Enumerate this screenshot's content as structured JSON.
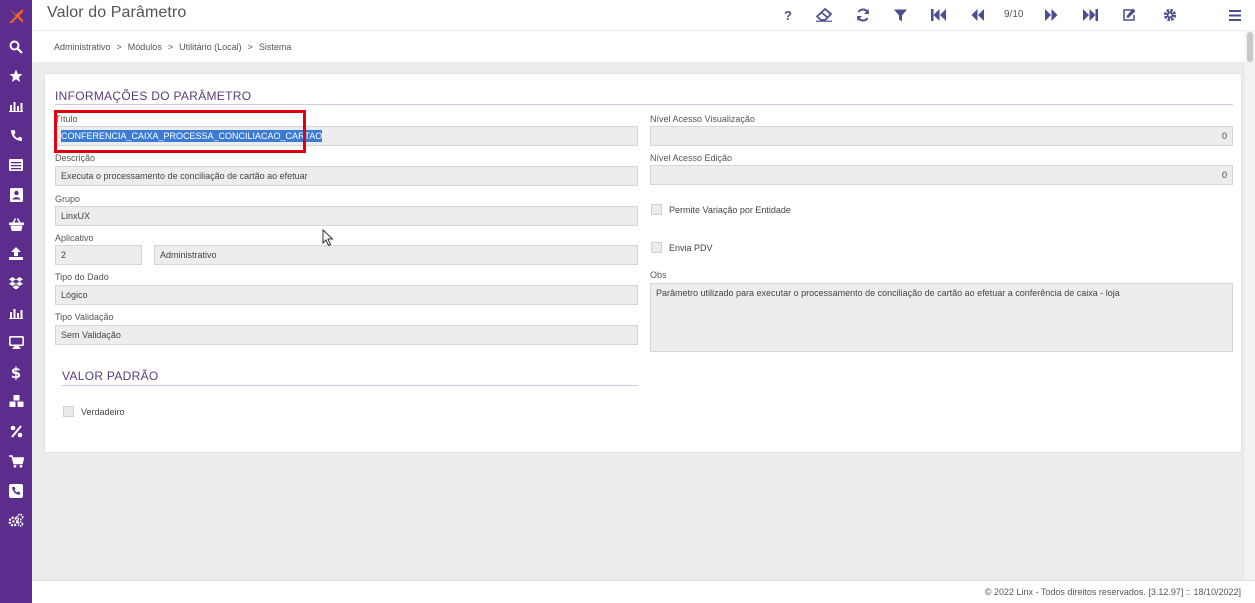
{
  "app": {
    "page_title": "Valor do Parâmetro"
  },
  "colors": {
    "sidebar": "#5c2d8c",
    "accent": "#5a3c7e",
    "selection": "#3a7bd5",
    "highlight_box": "#e0000f"
  },
  "sidebar": {
    "icons": [
      "search-icon",
      "star-icon",
      "bar-chart-icon",
      "phone-icon",
      "list-icon",
      "contact-card-icon",
      "basket-icon",
      "upload-icon",
      "dropbox-icon",
      "bar-chart-icon",
      "monitor-icon",
      "dollar-icon",
      "cubes-icon",
      "percent-icon",
      "cart-icon",
      "phone-square-icon",
      "gears-icon"
    ]
  },
  "toolbar": {
    "help": "?",
    "pager": "9/10",
    "icons": [
      "help-icon",
      "eraser-icon",
      "refresh-icon",
      "filter-icon",
      "first-record-icon",
      "previous-record-icon",
      "next-record-icon",
      "last-record-icon",
      "edit-icon",
      "settings-icon",
      "menu-icon"
    ]
  },
  "breadcrumb": [
    "Administrativo",
    "Módulos",
    "Utilitário (Local)",
    "Sistema"
  ],
  "breadcrumb_separator": ">",
  "info_section": {
    "title": "INFORMAÇÕES DO PARÂMETRO",
    "titulo": {
      "label": "Título",
      "value": "CONFERENCIA_CAIXA_PROCESSA_CONCILIACAO_CARTAO"
    },
    "descricao": {
      "label": "Descrição",
      "value": "Executa o processamento de conciliação de cartão ao efetuar"
    },
    "grupo": {
      "label": "Grupo",
      "value": "LinxUX"
    },
    "aplicativo": {
      "label": "Aplicativo",
      "code": "2",
      "name": "Administrativo"
    },
    "tipo_dado": {
      "label": "Tipo do Dado",
      "value": "Lógico"
    },
    "tipo_validacao": {
      "label": "Tipo Validação",
      "value": "Sem Validação"
    },
    "nivel_visualizacao": {
      "label": "Nível Acesso Visualização",
      "value": "0"
    },
    "nivel_edicao": {
      "label": "Nível Acesso Edição",
      "value": "0"
    },
    "permite_variacao": {
      "label": "Permite Variação por Entidade",
      "checked": false
    },
    "envia_pdv": {
      "label": "Envia PDV",
      "checked": false
    },
    "obs": {
      "label": "Obs",
      "value": "Parâmetro utilizado para executar o processamento de conciliação de cartão ao efetuar a conferência de caixa - loja"
    }
  },
  "default_section": {
    "title": "VALOR PADRÃO",
    "verdadeiro": {
      "label": "Verdadeiro",
      "checked": false
    }
  },
  "footer": {
    "text": "© 2022 Linx - Todos direitos reservados. [3.12.97] :: 18/10/2022]"
  }
}
